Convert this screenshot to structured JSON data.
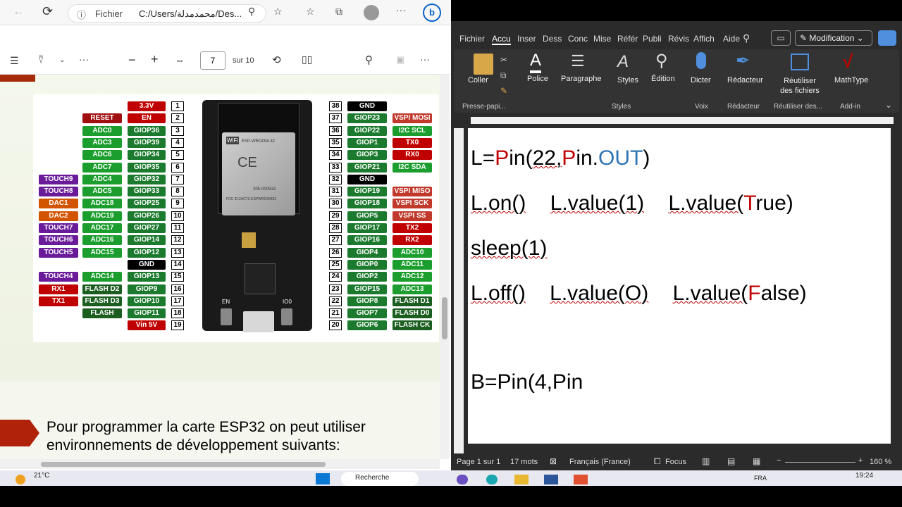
{
  "browser": {
    "address": "C:/Users/محمدمدلة/Des...",
    "file_label": "Fichier",
    "page_current": "7",
    "page_total": "sur 10"
  },
  "pinout": {
    "left": [
      {
        "num": "1",
        "name": "3.3V",
        "c": "#c00000",
        "extra": []
      },
      {
        "num": "2",
        "name": "EN",
        "c": "#c00000",
        "extra": [
          {
            "t": "RESET",
            "c": "#a01010"
          }
        ]
      },
      {
        "num": "3",
        "name": "GIOP36",
        "c": "#1b7a2d",
        "extra": [
          {
            "t": "ADC0",
            "c": "#1b9e2d"
          }
        ]
      },
      {
        "num": "4",
        "name": "GIOP39",
        "c": "#1b7a2d",
        "extra": [
          {
            "t": "ADC3",
            "c": "#1b9e2d"
          }
        ]
      },
      {
        "num": "5",
        "name": "GIOP34",
        "c": "#1b7a2d",
        "extra": [
          {
            "t": "ADC6",
            "c": "#1b9e2d"
          }
        ]
      },
      {
        "num": "6",
        "name": "GIOP35",
        "c": "#1b7a2d",
        "extra": [
          {
            "t": "ADC7",
            "c": "#1b9e2d"
          }
        ]
      },
      {
        "num": "7",
        "name": "GIOP32",
        "c": "#1b7a2d",
        "extra": [
          {
            "t": "ADC4",
            "c": "#1b9e2d"
          },
          {
            "t": "TOUCH9",
            "c": "#6a1b9a"
          }
        ]
      },
      {
        "num": "8",
        "name": "GIOP33",
        "c": "#1b7a2d",
        "extra": [
          {
            "t": "ADC5",
            "c": "#1b9e2d"
          },
          {
            "t": "TOUCH8",
            "c": "#6a1b9a"
          }
        ]
      },
      {
        "num": "9",
        "name": "GIOP25",
        "c": "#1b7a2d",
        "extra": [
          {
            "t": "ADC18",
            "c": "#1b9e2d"
          },
          {
            "t": "DAC1",
            "c": "#d35400"
          }
        ]
      },
      {
        "num": "10",
        "name": "GIOP26",
        "c": "#1b7a2d",
        "extra": [
          {
            "t": "ADC19",
            "c": "#1b9e2d"
          },
          {
            "t": "DAC2",
            "c": "#d35400"
          }
        ]
      },
      {
        "num": "11",
        "name": "GIOP27",
        "c": "#1b7a2d",
        "extra": [
          {
            "t": "ADC17",
            "c": "#1b9e2d"
          },
          {
            "t": "TOUCH7",
            "c": "#6a1b9a"
          }
        ]
      },
      {
        "num": "12",
        "name": "GIOP14",
        "c": "#1b7a2d",
        "extra": [
          {
            "t": "ADC16",
            "c": "#1b9e2d"
          },
          {
            "t": "TOUCH6",
            "c": "#6a1b9a"
          }
        ]
      },
      {
        "num": "13",
        "name": "GIOP12",
        "c": "#1b7a2d",
        "extra": [
          {
            "t": "ADC15",
            "c": "#1b9e2d"
          },
          {
            "t": "TOUCH5",
            "c": "#6a1b9a"
          }
        ]
      },
      {
        "num": "14",
        "name": "GND",
        "c": "#000",
        "extra": []
      },
      {
        "num": "15",
        "name": "GIOP13",
        "c": "#1b7a2d",
        "extra": [
          {
            "t": "ADC14",
            "c": "#1b9e2d"
          },
          {
            "t": "TOUCH4",
            "c": "#6a1b9a"
          }
        ]
      },
      {
        "num": "16",
        "name": "GIOP9",
        "c": "#1b7a2d",
        "extra": [
          {
            "t": "FLASH D2",
            "c": "#1b5e20"
          },
          {
            "t": "RX1",
            "c": "#c00000"
          }
        ]
      },
      {
        "num": "17",
        "name": "GIOP10",
        "c": "#1b7a2d",
        "extra": [
          {
            "t": "FLASH D3",
            "c": "#1b5e20"
          },
          {
            "t": "TX1",
            "c": "#c00000"
          }
        ]
      },
      {
        "num": "18",
        "name": "GIOP11",
        "c": "#1b7a2d",
        "extra": [
          {
            "t": "FLASH CMD",
            "c": "#1b5e20"
          }
        ]
      },
      {
        "num": "19",
        "name": "Vin 5V",
        "c": "#c00000",
        "extra": []
      }
    ],
    "right": [
      {
        "num": "38",
        "name": "GND",
        "c": "#000",
        "extra": []
      },
      {
        "num": "37",
        "name": "GIOP23",
        "c": "#1b7a2d",
        "extra": [
          {
            "t": "VSPI MOSI",
            "c": "#c0392b"
          }
        ]
      },
      {
        "num": "36",
        "name": "GIOP22",
        "c": "#1b7a2d",
        "extra": [
          {
            "t": "I2C SCL",
            "c": "#1b9e2d"
          }
        ]
      },
      {
        "num": "35",
        "name": "GIOP1",
        "c": "#1b7a2d",
        "extra": [
          {
            "t": "TX0",
            "c": "#c00000"
          }
        ]
      },
      {
        "num": "34",
        "name": "GIOP3",
        "c": "#1b7a2d",
        "extra": [
          {
            "t": "RX0",
            "c": "#c00000"
          }
        ]
      },
      {
        "num": "33",
        "name": "GIOP21",
        "c": "#1b7a2d",
        "extra": [
          {
            "t": "I2C SDA",
            "c": "#1b9e2d"
          }
        ]
      },
      {
        "num": "32",
        "name": "GND",
        "c": "#000",
        "extra": []
      },
      {
        "num": "31",
        "name": "GIOP19",
        "c": "#1b7a2d",
        "extra": [
          {
            "t": "VSPI MISO",
            "c": "#c0392b"
          }
        ]
      },
      {
        "num": "30",
        "name": "GIOP18",
        "c": "#1b7a2d",
        "extra": [
          {
            "t": "VSPI SCK",
            "c": "#c0392b"
          }
        ]
      },
      {
        "num": "29",
        "name": "GIOP5",
        "c": "#1b7a2d",
        "extra": [
          {
            "t": "VSPI SS",
            "c": "#c0392b"
          }
        ]
      },
      {
        "num": "28",
        "name": "GIOP17",
        "c": "#1b7a2d",
        "extra": [
          {
            "t": "TX2",
            "c": "#c00000"
          }
        ]
      },
      {
        "num": "27",
        "name": "GIOP16",
        "c": "#1b7a2d",
        "extra": [
          {
            "t": "RX2",
            "c": "#c00000"
          }
        ]
      },
      {
        "num": "26",
        "name": "GIOP4",
        "c": "#1b7a2d",
        "extra": [
          {
            "t": "ADC10",
            "c": "#1b9e2d"
          }
        ]
      },
      {
        "num": "25",
        "name": "GIOP0",
        "c": "#1b7a2d",
        "extra": [
          {
            "t": "ADC11",
            "c": "#1b9e2d"
          }
        ]
      },
      {
        "num": "24",
        "name": "GIOP2",
        "c": "#1b7a2d",
        "extra": [
          {
            "t": "ADC12",
            "c": "#1b9e2d"
          }
        ]
      },
      {
        "num": "23",
        "name": "GIOP15",
        "c": "#1b7a2d",
        "extra": [
          {
            "t": "ADC13",
            "c": "#1b9e2d"
          }
        ]
      },
      {
        "num": "22",
        "name": "GIOP8",
        "c": "#1b7a2d",
        "extra": [
          {
            "t": "FLASH D1",
            "c": "#1b5e20"
          }
        ]
      },
      {
        "num": "21",
        "name": "GIOP7",
        "c": "#1b7a2d",
        "extra": [
          {
            "t": "FLASH D0",
            "c": "#1b5e20"
          }
        ]
      },
      {
        "num": "20",
        "name": "GIOP6",
        "c": "#1b7a2d",
        "extra": [
          {
            "t": "FLASH CK",
            "c": "#1b5e20"
          }
        ]
      }
    ],
    "board_labels": {
      "module": "ESP-WROOM-32",
      "fcc": "FCC ID:2AC7Z-ESPWROOM32",
      "en": "EN",
      "io0": "IO0",
      "code": "205-000519"
    }
  },
  "slide_text": "Pour programmer la carte ESP32 on peut utiliser environnements de développement suivants:",
  "word": {
    "tabs": [
      "Fichier",
      "Accu",
      "Inser",
      "Dess",
      "Conc",
      "Mise",
      "Référ",
      "Publi",
      "Révis",
      "Affich",
      "Aide"
    ],
    "mode": "Modification",
    "groups": {
      "clipboard": "Presse-papi...",
      "styles": "Styles",
      "voice": "Voix",
      "editor": "Rédacteur",
      "reuse": "Réutiliser des...",
      "addin": "Add-in"
    },
    "buttons": {
      "paste": "Coller",
      "font": "Police",
      "paragraph": "Paragraphe",
      "styles": "Styles",
      "editing": "Édition",
      "dictate": "Dicter",
      "editor": "Rédacteur",
      "reuse": "Réutiliser des fichiers",
      "mathtype": "MathType"
    },
    "doc": {
      "l1a": "L=",
      "l1b": "P",
      "l1c": "in(",
      "l1d": "22,",
      "l1e": "P",
      "l1f": "in.",
      "l1g": "OUT",
      "l1h": ")",
      "l2a": "L.on()",
      "l2b": "L.value(1)",
      "l2c": "L.value(",
      "l2d": "T",
      "l2e": "rue)",
      "l3": "sleep(1)",
      "l4a": "L.off()",
      "l4b": "L.value(O)",
      "l4c": "L.value(",
      "l4d": "F",
      "l4e": "alse)",
      "l5": "B=Pin(4,Pin"
    },
    "status": {
      "page": "Page 1 sur 1",
      "words": "17 mots",
      "lang": "Français (France)",
      "focus": "Focus",
      "zoom": "160 %"
    }
  },
  "taskbar": {
    "weather": "21°C",
    "search": "Recherche",
    "time": "19:24",
    "lang": "FRA"
  }
}
